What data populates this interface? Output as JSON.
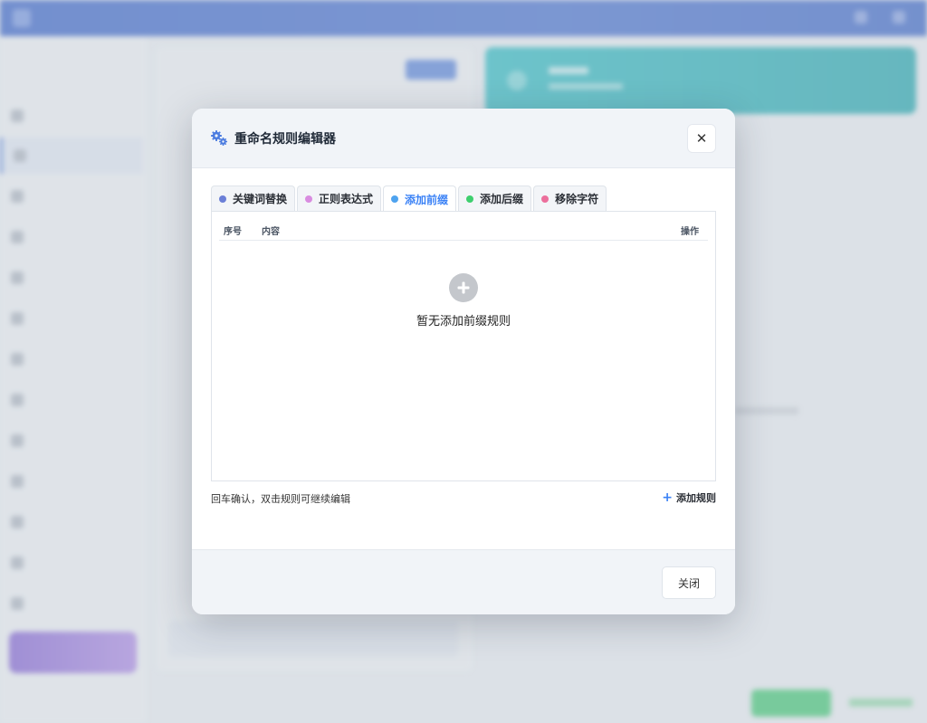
{
  "modal": {
    "title": "重命名规则编辑器",
    "close_icon_glyph": "✕",
    "tabs": [
      {
        "label": "关键词替换",
        "color": "#6b7fd7"
      },
      {
        "label": "正则表达式",
        "color": "#d98ce0"
      },
      {
        "label": "添加前缀",
        "color": "#4ea3ef"
      },
      {
        "label": "添加后缀",
        "color": "#3ecf6e"
      },
      {
        "label": "移除字符",
        "color": "#ec6f9c"
      }
    ],
    "active_tab": "添加前缀",
    "table": {
      "columns": [
        "序号",
        "内容",
        "操作"
      ],
      "empty_text": "暂无添加前缀规则"
    },
    "hint": "回车确认，双击规则可继续编辑",
    "add_rule_label": "添加规则",
    "close_button_label": "关闭"
  },
  "icons": {
    "header": "gears-icon",
    "close": "close-icon",
    "empty": "plus-circle-icon",
    "add": "plus-icon"
  },
  "colors": {
    "accent": "#3b82f6",
    "topbar": "#2d5bc4",
    "teal_card": "#1fb7bf",
    "green_button": "#34c46a"
  }
}
